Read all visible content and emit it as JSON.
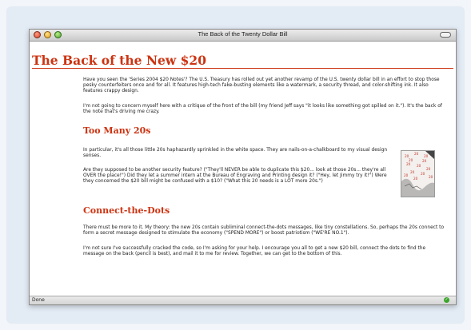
{
  "window": {
    "title": "The Back of the Twenty Dollar Bill"
  },
  "article": {
    "heading": "The Back of the New $20",
    "intro_1": "Have you seen the 'Series 2004 $20 Notes'? The U.S. Treasury has rolled out yet another revamp of the U.S. twenty dollar bill in an effort to stop those pesky counterfeiters once and for all. It features high-tech fake-busting elements like a watermark, a security thread, and color-shifting ink. It also features crappy design.",
    "intro_2": "I'm not going to concern myself here with a critique of the front of the bill (my friend Jeff says \"it looks like something got spilled on it.\"). It's the back of the note that's driving me crazy.",
    "section_1": {
      "heading": "Too Many 20s",
      "para_1": "In particular, it's all those little 20s haphazardly sprinkled in the white space. They are nails-on-a-chalkboard to my visual design senses.",
      "para_2": "Are they supposed to be another security feature? (\"They'll NEVER be able to duplicate this $20... look at those 20s... they're all OVER the place!\") Did they let a summer intern at the Bureau of Engraving and Printing design it? (\"Hey, let Jimmy try it!\") Were they concerned the $20 bill might be confused with a $10? (\"What this 20 needs is a LOT more 20s.\")"
    },
    "section_2": {
      "heading": "Connect-the-Dots",
      "para_1": "There must be more to it. My theory: the new 20s contain subliminal connect-the-dots messages, like tiny constellations. So, perhaps the 20s connect to form a secret message designed to stimulate the economy (\"SPEND MORE\") or boost patriotism (\"WE'RE NO.1\").",
      "para_2": "I'm not sure I've successfully cracked the code, so I'm asking for your help. I encourage you all to get a new $20 bill, connect the dots to find the message on the back (pencil is best), and mail it to me for review. Together, we can get to the bottom of this."
    }
  },
  "status": {
    "text": "Done"
  },
  "image": {
    "twenty_labels": [
      "20",
      "20",
      "20",
      "20",
      "20",
      "20",
      "20",
      "20",
      "20",
      "20",
      "20",
      "20",
      "20"
    ]
  }
}
